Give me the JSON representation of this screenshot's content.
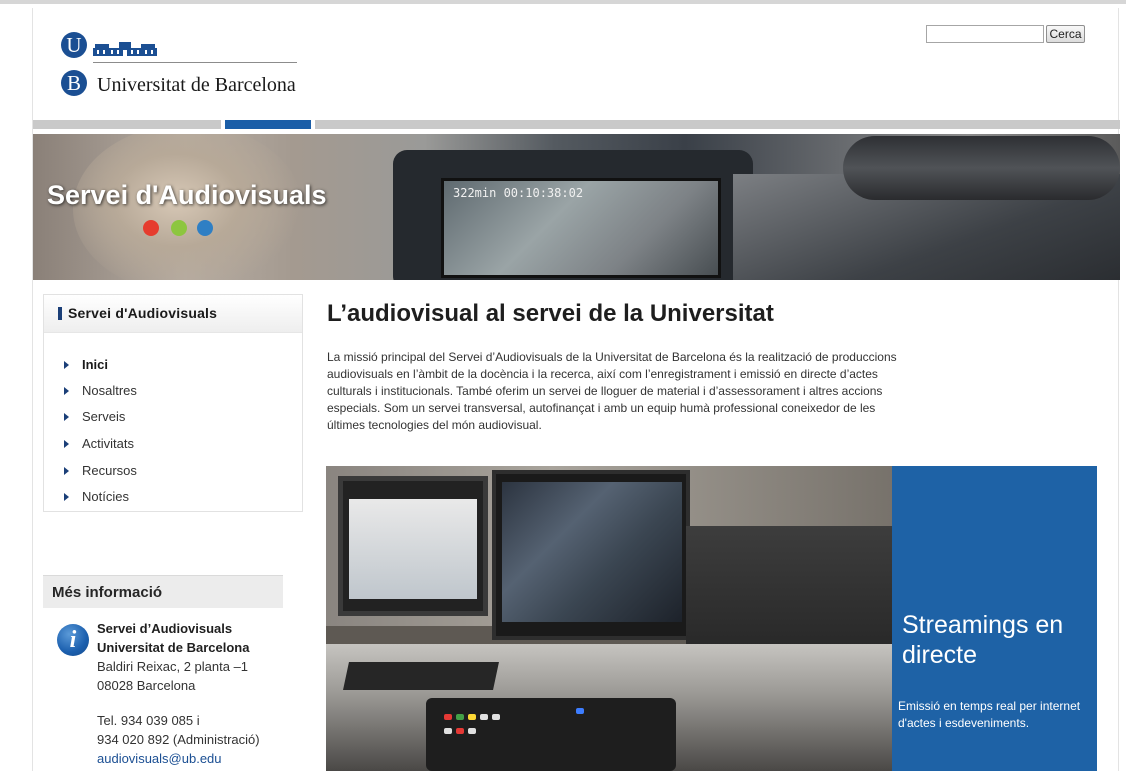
{
  "header": {
    "university_name": "Universitat de Barcelona",
    "logo_letter_top": "U",
    "logo_letter_bottom": "B",
    "search": {
      "placeholder": "",
      "value": "",
      "button_label": "Cerca"
    }
  },
  "banner": {
    "title": "Servei d'Audiovisuals",
    "camera_osd": "322min     00:10:38:02",
    "dot_colors": [
      "#e63c2e",
      "#8dc63f",
      "#2f7fc4"
    ]
  },
  "sidebar": {
    "section_title": "Servei d'Audiovisuals",
    "items": [
      {
        "label": "Inici",
        "current": true
      },
      {
        "label": "Nosaltres"
      },
      {
        "label": "Serveis"
      },
      {
        "label": "Activitats"
      },
      {
        "label": "Recursos"
      },
      {
        "label": "Notícies"
      }
    ]
  },
  "more_info": {
    "title": "Més informació",
    "org_line1": "Servei d’Audiovisuals",
    "org_line2": "Universitat de Barcelona",
    "address1": "Baldiri Reixac, 2 planta –1",
    "address2": "08028 Barcelona",
    "phone1": "Tel. 934 039 085 i",
    "phone2": "934 020 892 (Administració)",
    "email": "audiovisuals@ub.edu"
  },
  "main": {
    "title": "L’audiovisual al servei de la Universitat",
    "intro": "La missió principal del Servei d’Audiovisuals de la Universitat de Barcelona és la realització de produccions audiovisuals en l’àmbit de la docència i la recerca, així com l’enregistrament i emissió en directe d’actes culturals i institucionals. També oferim un servei de lloguer de material i d’assessorament i altres accions especials. Som un servei transversal, autofinançat i amb un equip humà professional coneixedor de les últimes tecnologies del món audiovisual.",
    "feature": {
      "title": "Streamings en directe",
      "text": "Emissió en temps real per internet d'actes i esdeveniments.",
      "color": "#1e62a6"
    }
  }
}
